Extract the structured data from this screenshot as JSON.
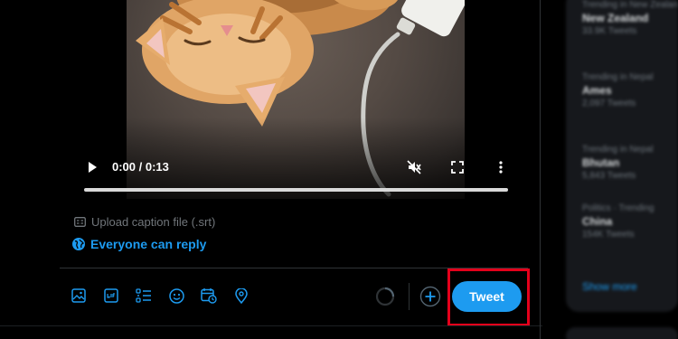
{
  "video": {
    "current_time": "0:00",
    "separator": " / ",
    "duration": "0:13",
    "progress": 0
  },
  "caption_upload": {
    "label": "Upload caption file (.srt)"
  },
  "reply_setting": {
    "label": "Everyone can reply"
  },
  "toolbar": {
    "tools": [
      "image-icon",
      "gif-icon",
      "poll-icon",
      "emoji-icon",
      "schedule-icon",
      "location-icon"
    ],
    "tweet_label": "Tweet"
  },
  "sidebar": {
    "trends": [
      {
        "meta": "Trending in New Zealand",
        "name": "New Zealand",
        "count": "33.9K Tweets"
      },
      {
        "meta": "Trending in Nepal",
        "name": "Ames",
        "count": "2,097 Tweets"
      },
      {
        "meta": "Trending in Nepal",
        "name": "Bhutan",
        "count": "5,843 Tweets"
      },
      {
        "meta": "Politics · Trending",
        "name": "China",
        "count": "154K Tweets"
      }
    ],
    "show_more": "Show more"
  },
  "colors": {
    "accent": "#1d9bf0",
    "highlight_box": "#e4001b",
    "background": "#000000"
  }
}
